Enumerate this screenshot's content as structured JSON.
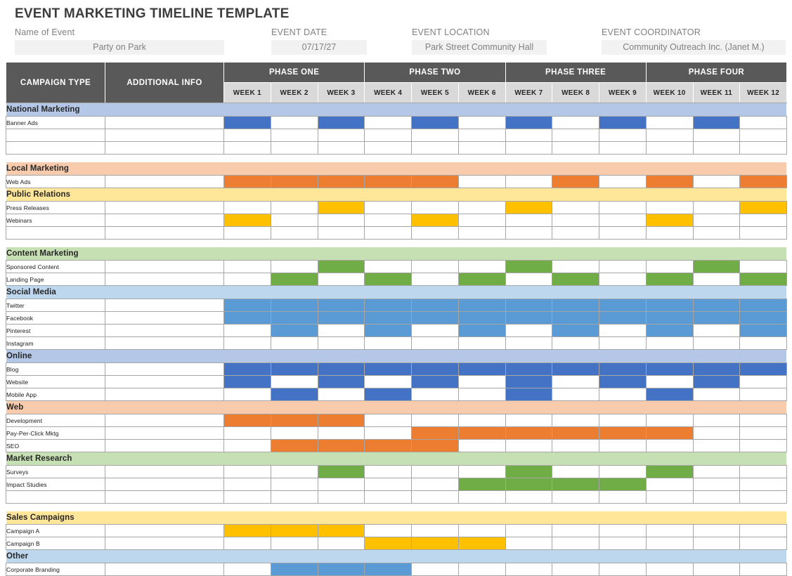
{
  "title": "EVENT MARKETING TIMELINE TEMPLATE",
  "meta": {
    "event_label": "Name of Event",
    "event_value": "Party on Park",
    "date_label": "EVENT DATE",
    "date_value": "07/17/27",
    "location_label": "EVENT LOCATION",
    "location_value": "Park Street Community Hall",
    "coordinator_label": "EVENT COORDINATOR",
    "coordinator_value": "Community Outreach Inc. (Janet M.)"
  },
  "header": {
    "campaign_type": "CAMPAIGN TYPE",
    "additional_info": "ADDITIONAL INFO",
    "phases": [
      "PHASE ONE",
      "PHASE TWO",
      "PHASE THREE",
      "PHASE FOUR"
    ],
    "weeks": [
      "WEEK 1",
      "WEEK 2",
      "WEEK 3",
      "WEEK 4",
      "WEEK 5",
      "WEEK 6",
      "WEEK 7",
      "WEEK 8",
      "WEEK 9",
      "WEEK 10",
      "WEEK 11",
      "WEEK 12"
    ]
  },
  "colors": {
    "band_blue_dark": "#b4c7e7",
    "band_blue_light": "#bdd7ee",
    "band_peach": "#f8cbad",
    "band_yellow": "#ffe699",
    "band_green": "#c6e0b4",
    "bar_blue_dark": "#4472c4",
    "bar_blue_light": "#5b9bd5",
    "bar_orange": "#ed7d31",
    "bar_yellow": "#ffc000",
    "bar_green": "#70ad47",
    "header_gray": "#595959",
    "week_gray": "#d9d9d9"
  },
  "sections": [
    {
      "name": "National Marketing",
      "band": "#b4c7e7",
      "bar": "#4472c4",
      "rows": [
        {
          "label": "Banner Ads",
          "info": "",
          "weeks": [
            1,
            0,
            1,
            0,
            1,
            0,
            1,
            0,
            1,
            0,
            1,
            0
          ]
        },
        {
          "label": "",
          "info": "",
          "weeks": [
            0,
            0,
            0,
            0,
            0,
            0,
            0,
            0,
            0,
            0,
            0,
            0
          ]
        },
        {
          "label": "",
          "info": "",
          "weeks": [
            0,
            0,
            0,
            0,
            0,
            0,
            0,
            0,
            0,
            0,
            0,
            0
          ]
        }
      ],
      "spacer_after": true
    },
    {
      "name": "Local Marketing",
      "band": "#f8cbad",
      "bar": "#ed7d31",
      "rows": [
        {
          "label": "Web Ads",
          "info": "",
          "weeks": [
            1,
            1,
            1,
            1,
            1,
            0,
            0,
            1,
            0,
            1,
            0,
            1
          ]
        }
      ],
      "spacer_after": false
    },
    {
      "name": "Public Relations",
      "band": "#ffe699",
      "bar": "#ffc000",
      "rows": [
        {
          "label": "Press Releases",
          "info": "",
          "weeks": [
            0,
            0,
            1,
            0,
            0,
            0,
            1,
            0,
            0,
            0,
            0,
            1
          ]
        },
        {
          "label": "Webinars",
          "info": "",
          "weeks": [
            1,
            0,
            0,
            0,
            1,
            0,
            0,
            0,
            0,
            1,
            0,
            0
          ]
        },
        {
          "label": "",
          "info": "",
          "weeks": [
            0,
            0,
            0,
            0,
            0,
            0,
            0,
            0,
            0,
            0,
            0,
            0
          ]
        }
      ],
      "spacer_after": true
    },
    {
      "name": "Content Marketing",
      "band": "#c6e0b4",
      "bar": "#70ad47",
      "rows": [
        {
          "label": "Sponsored Content",
          "info": "",
          "weeks": [
            0,
            0,
            1,
            0,
            0,
            0,
            1,
            0,
            0,
            0,
            1,
            0
          ]
        },
        {
          "label": "Landing Page",
          "info": "",
          "weeks": [
            0,
            1,
            0,
            1,
            0,
            1,
            0,
            1,
            0,
            1,
            0,
            1
          ]
        }
      ],
      "spacer_after": false
    },
    {
      "name": "Social Media",
      "band": "#bdd7ee",
      "bar": "#5b9bd5",
      "rows": [
        {
          "label": "Twitter",
          "info": "",
          "weeks": [
            1,
            1,
            1,
            1,
            1,
            1,
            1,
            1,
            1,
            1,
            1,
            1
          ]
        },
        {
          "label": "Facebook",
          "info": "",
          "weeks": [
            1,
            1,
            1,
            1,
            1,
            1,
            1,
            1,
            1,
            1,
            1,
            1
          ]
        },
        {
          "label": "Pinterest",
          "info": "",
          "weeks": [
            0,
            1,
            0,
            1,
            0,
            1,
            0,
            1,
            0,
            1,
            0,
            1
          ]
        },
        {
          "label": "Instagram",
          "info": "",
          "weeks": [
            0,
            0,
            0,
            0,
            0,
            0,
            0,
            0,
            0,
            0,
            0,
            0
          ]
        }
      ],
      "spacer_after": false
    },
    {
      "name": "Online",
      "band": "#b4c7e7",
      "bar": "#4472c4",
      "rows": [
        {
          "label": "Blog",
          "info": "",
          "weeks": [
            1,
            1,
            1,
            1,
            1,
            1,
            1,
            1,
            1,
            1,
            1,
            1
          ]
        },
        {
          "label": "Website",
          "info": "",
          "weeks": [
            1,
            0,
            1,
            0,
            1,
            0,
            1,
            0,
            1,
            0,
            1,
            0
          ]
        },
        {
          "label": "Mobile App",
          "info": "",
          "weeks": [
            0,
            1,
            0,
            1,
            0,
            0,
            1,
            0,
            0,
            1,
            0,
            0
          ]
        }
      ],
      "spacer_after": false
    },
    {
      "name": "Web",
      "band": "#f8cbad",
      "bar": "#ed7d31",
      "rows": [
        {
          "label": "Development",
          "info": "",
          "weeks": [
            1,
            1,
            1,
            0,
            0,
            0,
            0,
            0,
            0,
            0,
            0,
            0
          ]
        },
        {
          "label": "Pay-Per-Click Mktg",
          "info": "",
          "weeks": [
            0,
            0,
            0,
            0,
            1,
            1,
            1,
            1,
            1,
            1,
            0,
            0
          ]
        },
        {
          "label": "SEO",
          "info": "",
          "weeks": [
            0,
            1,
            1,
            1,
            1,
            0,
            0,
            0,
            0,
            0,
            0,
            0
          ]
        }
      ],
      "spacer_after": false
    },
    {
      "name": "Market Research",
      "band": "#c6e0b4",
      "bar": "#70ad47",
      "rows": [
        {
          "label": "Surveys",
          "info": "",
          "weeks": [
            0,
            0,
            1,
            0,
            0,
            0,
            1,
            0,
            0,
            1,
            0,
            0
          ]
        },
        {
          "label": "Impact Studies",
          "info": "",
          "weeks": [
            0,
            0,
            0,
            0,
            0,
            1,
            1,
            1,
            1,
            0,
            0,
            0
          ]
        },
        {
          "label": "",
          "info": "",
          "weeks": [
            0,
            0,
            0,
            0,
            0,
            0,
            0,
            0,
            0,
            0,
            0,
            0
          ]
        }
      ],
      "spacer_after": true
    },
    {
      "name": "Sales Campaigns",
      "band": "#ffe699",
      "bar": "#ffc000",
      "rows": [
        {
          "label": "Campaign A",
          "info": "",
          "weeks": [
            1,
            1,
            1,
            0,
            0,
            0,
            0,
            0,
            0,
            0,
            0,
            0
          ]
        },
        {
          "label": "Campaign B",
          "info": "",
          "weeks": [
            0,
            0,
            0,
            1,
            1,
            1,
            0,
            0,
            0,
            0,
            0,
            0
          ]
        }
      ],
      "spacer_after": false
    },
    {
      "name": "Other",
      "band": "#bdd7ee",
      "bar": "#5b9bd5",
      "rows": [
        {
          "label": "Corporate Branding",
          "info": "",
          "weeks": [
            0,
            1,
            1,
            1,
            0,
            0,
            0,
            0,
            0,
            0,
            0,
            0
          ]
        }
      ],
      "spacer_after": false
    }
  ]
}
